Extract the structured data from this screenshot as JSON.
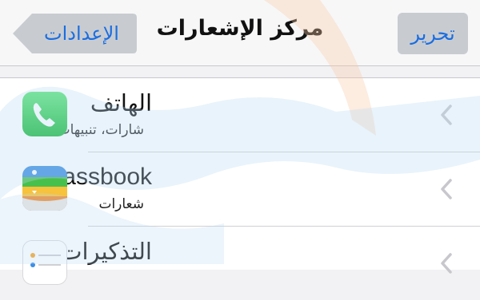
{
  "navbar": {
    "title": "مركز الإشعارات",
    "edit_label": "تحرير",
    "back_label": "الإعدادات"
  },
  "rows": [
    {
      "label": "الهاتف",
      "sub": "شارات، تنبيهات",
      "icon": "phone-icon"
    },
    {
      "label": "Passbook",
      "sub": "شعارات",
      "icon": "passbook-icon"
    },
    {
      "label": "التذكيرات",
      "sub": "",
      "icon": "reminders-icon"
    }
  ],
  "colors": {
    "accent": "#1a6de0",
    "phone_green": "#2fcf4f"
  }
}
